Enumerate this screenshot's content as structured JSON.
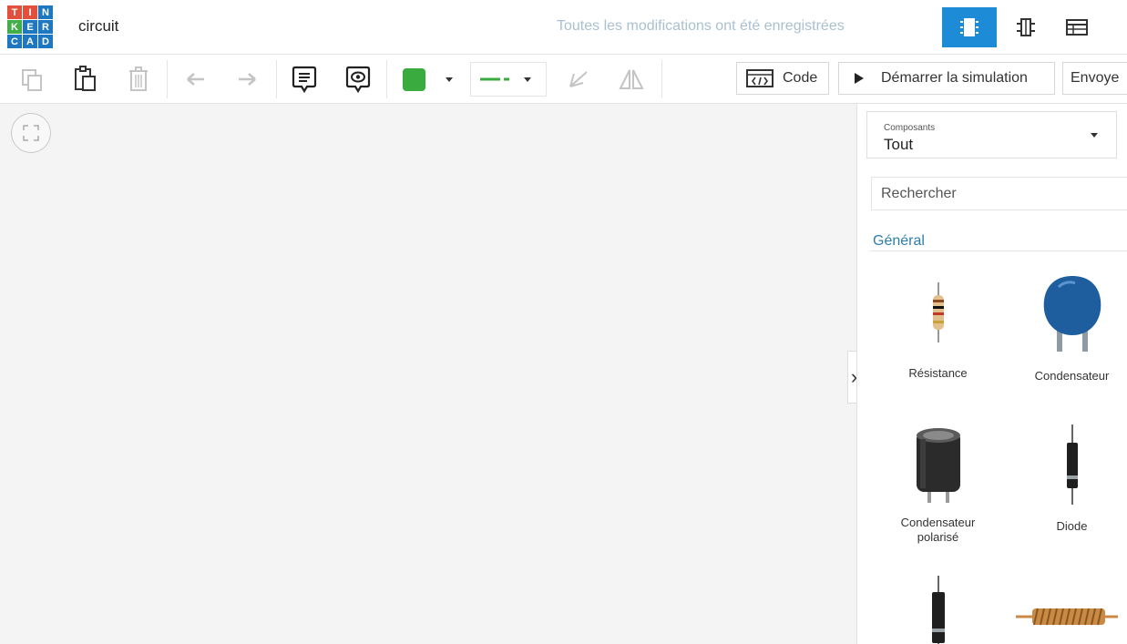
{
  "app": {
    "logo_letters": [
      "T",
      "I",
      "N",
      "K",
      "E",
      "R",
      "C",
      "A",
      "D"
    ],
    "logo_colors": [
      "#e2503d",
      "#e2503d",
      "#1d78c1",
      "#43ad49",
      "#1d78c1",
      "#1d78c1",
      "#1d78c1",
      "#1d78c1",
      "#1d78c1"
    ],
    "project_title": "circuit",
    "save_status": "Toutes les modifications ont été enregistrées",
    "accent_color": "#1d8bd6"
  },
  "header": {
    "views": [
      {
        "name": "circuit-view",
        "icon": "chip-icon",
        "active": true
      },
      {
        "name": "schematic-view",
        "icon": "schematic-icon",
        "active": false
      },
      {
        "name": "component-list-view",
        "icon": "list-icon",
        "active": false
      }
    ]
  },
  "toolbar": {
    "tools": [
      "copy-icon",
      "paste-icon",
      "delete-icon",
      "undo-icon",
      "redo-icon",
      "note-icon",
      "notes-visibility-icon",
      "rotate-icon",
      "mirror-icon"
    ],
    "color_swatch": "#3aab3e",
    "wire_color": "#3aab3e",
    "code_label": "Code",
    "simulate_label": "Démarrer la simulation",
    "send_label": "Envoye"
  },
  "panel": {
    "components_label": "Composants",
    "components_value": "Tout",
    "search_placeholder": "Rechercher",
    "section_title": "Général",
    "components": [
      {
        "name": "Résistance",
        "icon": "resistor-icon"
      },
      {
        "name": "Condensateur",
        "icon": "capacitor-icon"
      },
      {
        "name_line1": "Condensateur",
        "name_line2": "polarisé",
        "icon": "polarized-capacitor-icon"
      },
      {
        "name": "Diode",
        "icon": "diode-icon"
      },
      {
        "name": "",
        "icon": "zener-diode-icon"
      },
      {
        "name": "",
        "icon": "inductor-icon"
      }
    ]
  }
}
